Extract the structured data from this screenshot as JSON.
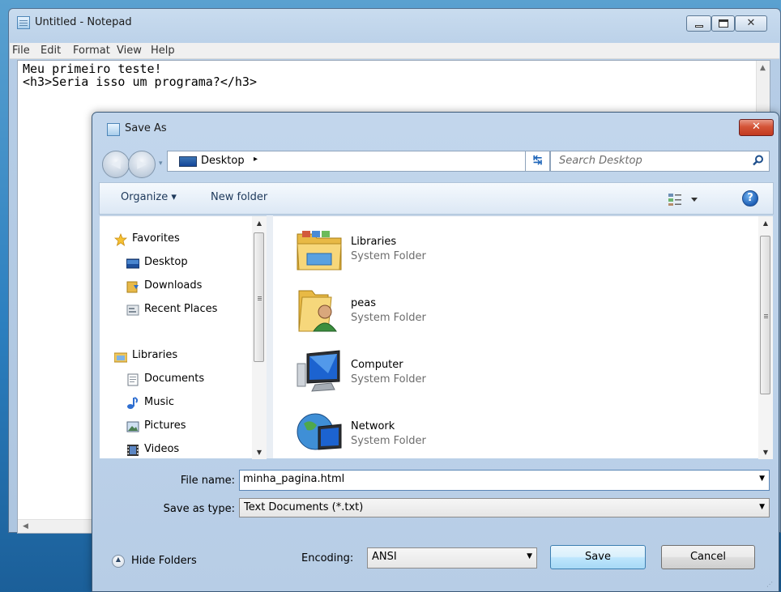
{
  "notepad": {
    "title": "Untitled - Notepad",
    "menu": [
      "File",
      "Edit",
      "Format",
      "View",
      "Help"
    ],
    "text_lines": [
      "Meu primeiro teste!",
      "<h3>Seria isso um programa?</h3>"
    ]
  },
  "dialog": {
    "title": "Save As",
    "address": {
      "location": "Desktop",
      "chevron": "▸"
    },
    "search": {
      "placeholder": "Search Desktop"
    },
    "toolbar": {
      "organize": "Organize ▾",
      "new_folder": "New folder",
      "help": "?"
    },
    "nav": {
      "favorites": {
        "label": "Favorites",
        "items": [
          "Desktop",
          "Downloads",
          "Recent Places"
        ]
      },
      "libraries": {
        "label": "Libraries",
        "items": [
          "Documents",
          "Music",
          "Pictures",
          "Videos"
        ]
      }
    },
    "files": [
      {
        "name": "Libraries",
        "type": "System Folder",
        "icon": "libraries-icon"
      },
      {
        "name": "peas",
        "type": "System Folder",
        "icon": "user-folder-icon"
      },
      {
        "name": "Computer",
        "type": "System Folder",
        "icon": "computer-icon"
      },
      {
        "name": "Network",
        "type": "System Folder",
        "icon": "network-icon"
      }
    ],
    "form": {
      "file_name_label": "File name:",
      "file_name_value": "minha_pagina.html",
      "save_type_label": "Save as type:",
      "save_type_value": "Text Documents (*.txt)",
      "encoding_label": "Encoding:",
      "encoding_value": "ANSI"
    },
    "buttons": {
      "hide_folders": "Hide Folders",
      "save": "Save",
      "cancel": "Cancel"
    }
  }
}
